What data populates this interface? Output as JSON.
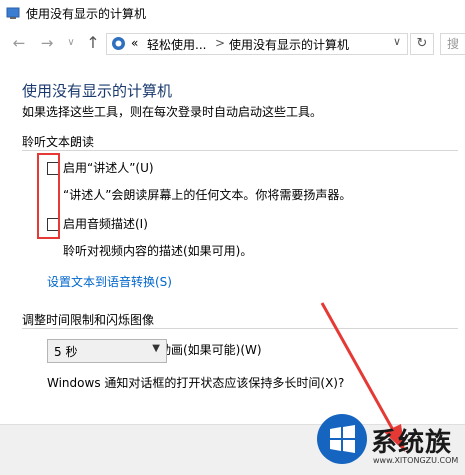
{
  "window": {
    "title": "使用没有显示的计算机"
  },
  "nav": {
    "back": "←",
    "forward": "→",
    "dropdown": "∨",
    "up": "↑",
    "address": {
      "prefix": "«",
      "crumb1": "轻松使用...",
      "sep": ">",
      "crumb2": "使用没有显示的计算机",
      "chevron": "∨"
    },
    "refresh": "↻",
    "search_placeholder": "搜"
  },
  "page": {
    "title": "使用没有显示的计算机",
    "subtitle": "如果选择这些工具，则在每次登录时自动启动这些工具。"
  },
  "section_tts": {
    "title": "聆听文本朗读",
    "narrator_label": "启用“讲述人”(U)",
    "narrator_desc": "“讲述人”会朗读屏幕上的任何文本。你将需要扬声器。",
    "audio_desc_label": "启用音频描述(I)",
    "audio_desc_desc": "聆听对视频内容的描述(如果可用)。",
    "link": "设置文本到语音转换(S)"
  },
  "section_time": {
    "title": "调整时间限制和闪烁图像",
    "anim_label": "关闭所有不必要的动画(如果可能)(W)",
    "notify_question": "Windows 通知对话框的打开状态应该保持多长时间(X)?",
    "notify_value": "5 秒"
  },
  "watermark": {
    "brand": "系统族",
    "url": "www.XITONGZU.COM"
  },
  "colors": {
    "highlight": "#e53935",
    "title_blue": "#1a3a6e",
    "link_blue": "#0066cc"
  }
}
